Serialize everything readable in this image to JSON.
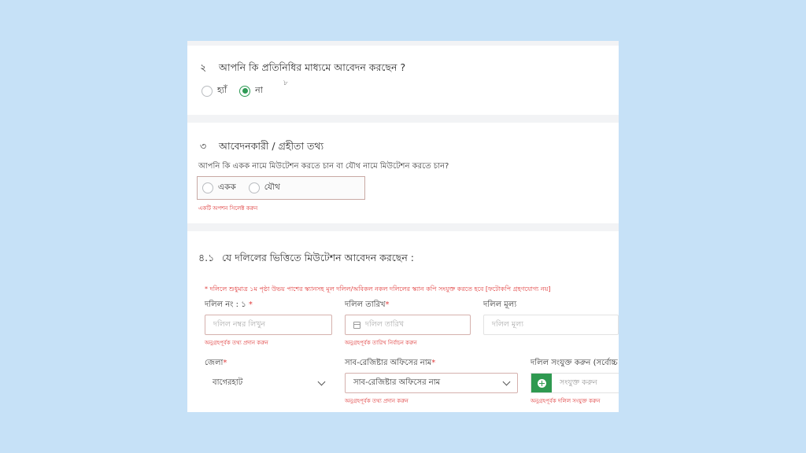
{
  "section2": {
    "number": "২",
    "title": "আপনি কি প্রতিনিধির মাধ্যমে আবেদন করছেন ?",
    "stray_mark": "৮",
    "options": [
      {
        "label": "হ্যাঁ",
        "checked": false
      },
      {
        "label": "না",
        "checked": true
      }
    ]
  },
  "section3": {
    "number": "৩",
    "title": "আবেদনকারী / গ্রহীতা তথ্য",
    "question": "আপনি কি একক নামে মিউটেশন করতে চান বা যৌথ নামে মিউটেশন করতে চান?",
    "options": [
      {
        "label": "একক",
        "checked": false
      },
      {
        "label": "যৌথ",
        "checked": false
      }
    ],
    "error": "একটি অপশন সিলেক্ট করুন"
  },
  "section4": {
    "number": "৪.১",
    "title": "যে দলিলের ভিত্তিতে মিউটেশন আবেদন করছেন :",
    "notice": "* দলিলে শুধুমাত্র ১ম পৃষ্ঠা উভয় পাশের স্ক্যানসহ মূল দলিল/অবিকল নকল দলিলের স্ক্যান কপি সংযুক্ত করতে হবে [ফটোকপি গ্রহণযোগ্য নয়]",
    "fields": {
      "deed_no": {
        "label": "দলিল নং : ১",
        "required_mark": "*",
        "placeholder": "দলিল নম্বর লিখুন",
        "error": "অনুগ্রহপূর্বক তথ্য প্রদান করুন"
      },
      "deed_date": {
        "label": "দলিল তারিখ",
        "required_mark": "*",
        "placeholder": "দলিল তারিখ",
        "error": "অনুগ্রহপূর্বক তারিখ নির্বাচন করুন"
      },
      "deed_value": {
        "label": "দলিল মূল্য",
        "placeholder": "দলিল মূল্য"
      },
      "district": {
        "label": "জেলা",
        "required_mark": "*",
        "value": "বাগেরহাট"
      },
      "subregistry": {
        "label": "সাব-রেজিষ্টার অফিসের নাম",
        "required_mark": "*",
        "value": "সাব-রেজিষ্টার অফিসের নাম",
        "error": "অনুগ্রহপূর্বক তথ্য প্রদান করুন"
      },
      "attach": {
        "label": "দলিল সংযুক্ত করুন (সর্বোচ্চ",
        "button_text": "সংযুক্ত করুন",
        "error": "অনুগ্রহপূর্বক দলিল সংযুক্ত করুন"
      }
    }
  },
  "colors": {
    "background": "#c6e1f7",
    "accent_green": "#2e9950",
    "error_red": "#e03c3c"
  }
}
